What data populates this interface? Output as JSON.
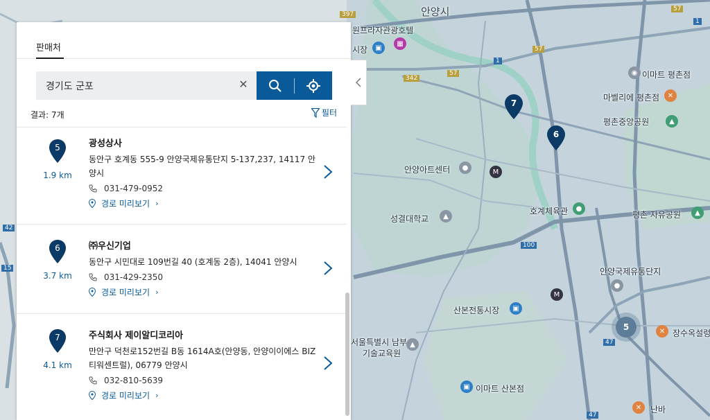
{
  "map": {
    "labels": [
      {
        "text": "안양시",
        "big": true
      },
      {
        "text": "안양아트센터"
      },
      {
        "text": "호계체육관"
      },
      {
        "text": "성결대학교"
      },
      {
        "text": "안양국제유통단지"
      },
      {
        "text": "산본전통시장"
      },
      {
        "text": "서울특별시 남부"
      },
      {
        "text": "기술교육원"
      },
      {
        "text": "이마트 산본점"
      },
      {
        "text": "이마트 평촌점"
      },
      {
        "text": "마벨리에 평촌점"
      },
      {
        "text": "평촌중앙공원"
      },
      {
        "text": "평촌 자유공원"
      },
      {
        "text": "장수옥설렁탕"
      },
      {
        "text": "난바"
      },
      {
        "text": "원프라자관광호텔"
      },
      {
        "text": "시장"
      }
    ],
    "route_numbers": [
      "397",
      "57",
      "57",
      "342",
      "57",
      "1",
      "1",
      "100",
      "47",
      "47",
      "15",
      "42"
    ],
    "markers": [
      {
        "number": "7"
      },
      {
        "number": "6"
      }
    ],
    "cluster": {
      "count": "5"
    }
  },
  "panel": {
    "tab_label": "판매처",
    "search": {
      "value": "경기도 군포",
      "placeholder": ""
    },
    "result_count": "결과: 7개",
    "filter_label": "필터",
    "items": [
      {
        "pin": "5",
        "distance": "1.9 km",
        "name": "광성상사",
        "address": "동안구 호계동 555-9 안양국제유통단지 5-137,237, 14117 안양시",
        "phone": "031-479-0952",
        "route_label": "경로 미리보기"
      },
      {
        "pin": "6",
        "distance": "3.7 km",
        "name": "㈜우신기업",
        "address": "동안구 시민대로 109번길 40 (호계동 2층), 14041 안양시",
        "phone": "031-429-2350",
        "route_label": "경로 미리보기"
      },
      {
        "pin": "7",
        "distance": "4.1 km",
        "name": "주식회사 제이알디코리아",
        "address": "만안구 덕천로152번길 B동 1614A호(안양동, 안양이이에스 BIZ 티워센트럴), 06779 안양시",
        "phone": "032-810-5639",
        "route_label": "경로 미리보기"
      }
    ]
  },
  "colors": {
    "accent": "#0a5a9a",
    "pin": "#0b3a66",
    "map_water": "#9fd1c7",
    "map_road": "#8da4b8"
  }
}
